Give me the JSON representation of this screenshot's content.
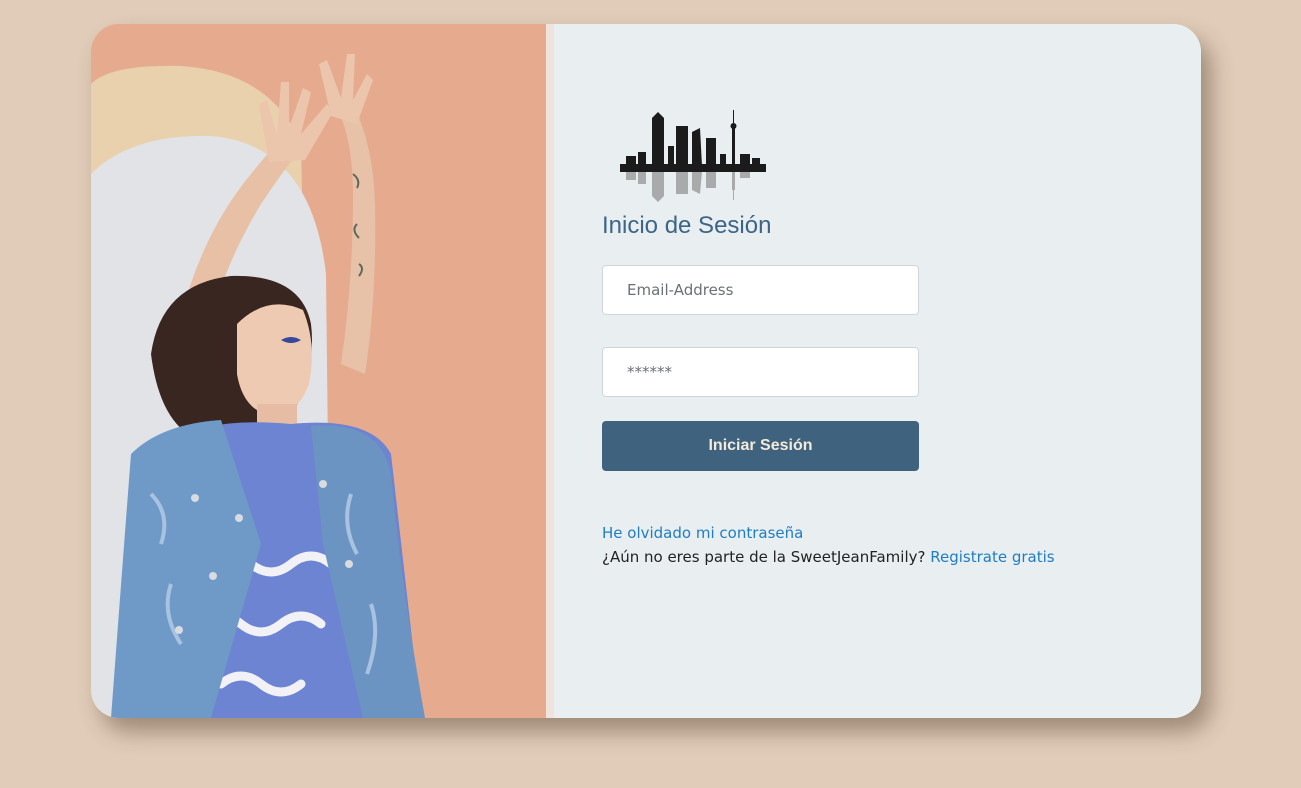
{
  "login": {
    "title": "Inicio de Sesión",
    "email_placeholder": "Email-Address",
    "password_placeholder": "******",
    "submit_label": "Iniciar Sesión",
    "forgot_link": "He olvidado mi contraseña",
    "signup_prompt": "¿Aún no eres parte de la SweetJeanFamily?",
    "signup_link": "Registrate gratis"
  },
  "icons": {
    "logo": "city-skyline-logo-icon"
  },
  "colors": {
    "page_background": "#e0ccb8",
    "panel_background": "#e9eef1",
    "accent": "#3f637f",
    "title": "#3d6585",
    "link": "#1f7ec2"
  }
}
